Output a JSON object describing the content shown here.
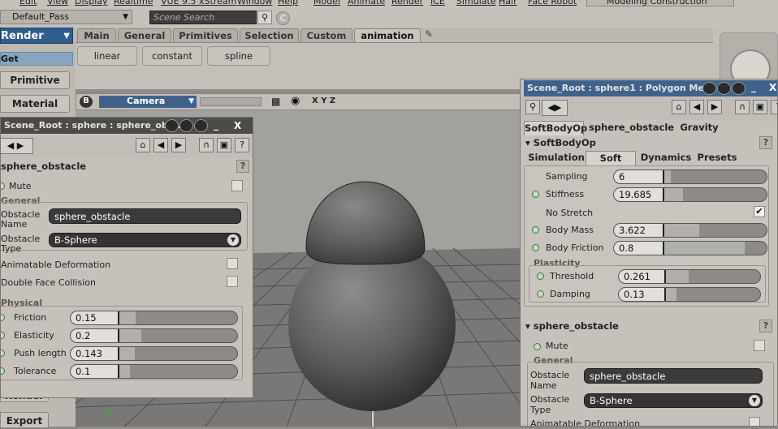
{
  "menubar": {
    "items": [
      "Edit",
      "View",
      "Display",
      "Realtime",
      "VUE 9.5 xStream",
      "Window",
      "Help",
      "Model",
      "Animate",
      "Render",
      "ICE",
      "Simulate",
      "Hair",
      "Face Robot"
    ],
    "mode": "Modeling Construction Mode"
  },
  "toolbar": {
    "pass": "Default_Pass",
    "search_placeholder": "Scene Search"
  },
  "left": {
    "render": "Render",
    "get": "Get",
    "primitive": "Primitive",
    "material": "Material",
    "render2": "Render",
    "export": "Export"
  },
  "tabs": [
    "Main",
    "General",
    "Primitives",
    "Selection",
    "Custom",
    "animation"
  ],
  "anim_buttons": [
    "linear",
    "constant",
    "spline"
  ],
  "viewport": {
    "camera": "Camera",
    "axes": "X Y Z",
    "b": "B",
    "y_axis": "Y"
  },
  "left_panel": {
    "title": "Scene_Root : sphere : sphere_obst...",
    "section": "sphere_obstacle",
    "mute": "Mute",
    "general": "General",
    "obstacle_name_label": "Obstacle Name",
    "obstacle_name": "sphere_obstacle",
    "obstacle_type_label": "Obstacle Type",
    "obstacle_type": "B-Sphere",
    "animatable": "Animatable Deformation",
    "double_face": "Double Face Collision",
    "physical": "Physical",
    "params": [
      {
        "label": "Friction",
        "value": "0.15",
        "fill": 0.15
      },
      {
        "label": "Elasticity",
        "value": "0.2",
        "fill": 0.2
      },
      {
        "label": "Push length",
        "value": "0.143",
        "fill": 0.143
      },
      {
        "label": "Tolerance",
        "value": "0.1",
        "fill": 0.1
      }
    ]
  },
  "right_panel": {
    "title": "Scene_Root : sphere1 : Polygon Me...",
    "top_tabs": [
      "SoftBodyOp",
      "sphere_obstacle",
      "Gravity"
    ],
    "section": "SoftBodyOp",
    "sub_tabs": [
      "Simulation",
      "Soft Body",
      "Dynamics",
      "Presets"
    ],
    "params": [
      {
        "label": "Sampling",
        "value": "6",
        "fill": 0.06,
        "led": false
      },
      {
        "label": "Stiffness",
        "value": "19.685",
        "fill": 0.2,
        "led": true
      },
      {
        "label": "Body Mass",
        "value": "3.622",
        "fill": 0.36,
        "led": true
      },
      {
        "label": "Body Friction",
        "value": "0.8",
        "fill": 0.8,
        "led": true
      }
    ],
    "no_stretch": "No Stretch",
    "plasticity": "Plasticity",
    "plast_params": [
      {
        "label": "Threshold",
        "value": "0.261",
        "fill": 0.26
      },
      {
        "label": "Damping",
        "value": "0.13",
        "fill": 0.13
      }
    ],
    "section2": "sphere_obstacle",
    "mute": "Mute",
    "general": "General",
    "obstacle_name_label": "Obstacle Name",
    "obstacle_name": "sphere_obstacle",
    "obstacle_type_label": "Obstacle Type",
    "obstacle_type": "B-Sphere",
    "animatable": "Animatable Deformation"
  }
}
